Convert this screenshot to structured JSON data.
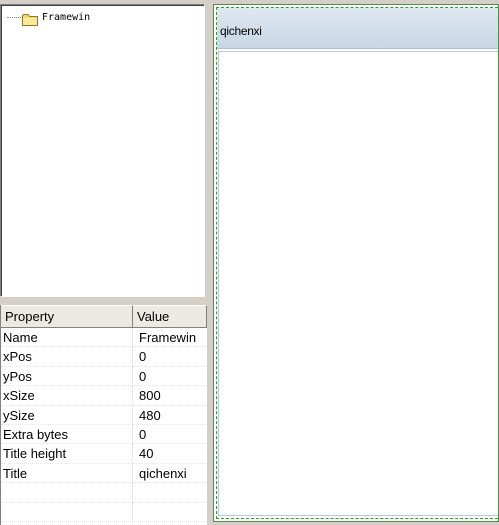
{
  "tree": {
    "nodes": [
      {
        "label": "Framewin",
        "icon": "folder-icon"
      }
    ]
  },
  "properties": {
    "headers": {
      "property": "Property",
      "value": "Value"
    },
    "rows": [
      {
        "name": "Name",
        "value": "Framewin"
      },
      {
        "name": "xPos",
        "value": "0"
      },
      {
        "name": "yPos",
        "value": "0"
      },
      {
        "name": "xSize",
        "value": "800"
      },
      {
        "name": "ySize",
        "value": "480"
      },
      {
        "name": "Extra bytes",
        "value": "0"
      },
      {
        "name": "Title height",
        "value": "40"
      },
      {
        "name": "Title",
        "value": "qichenxi"
      },
      {
        "name": "",
        "value": ""
      },
      {
        "name": "",
        "value": ""
      }
    ]
  },
  "preview": {
    "title": "qichenxi"
  },
  "colors": {
    "window_bg": "#d4d0c8",
    "frame_border": "#4f8a4f",
    "titlebar_top": "#dfe8f1",
    "titlebar_bottom": "#c8d6e5"
  }
}
